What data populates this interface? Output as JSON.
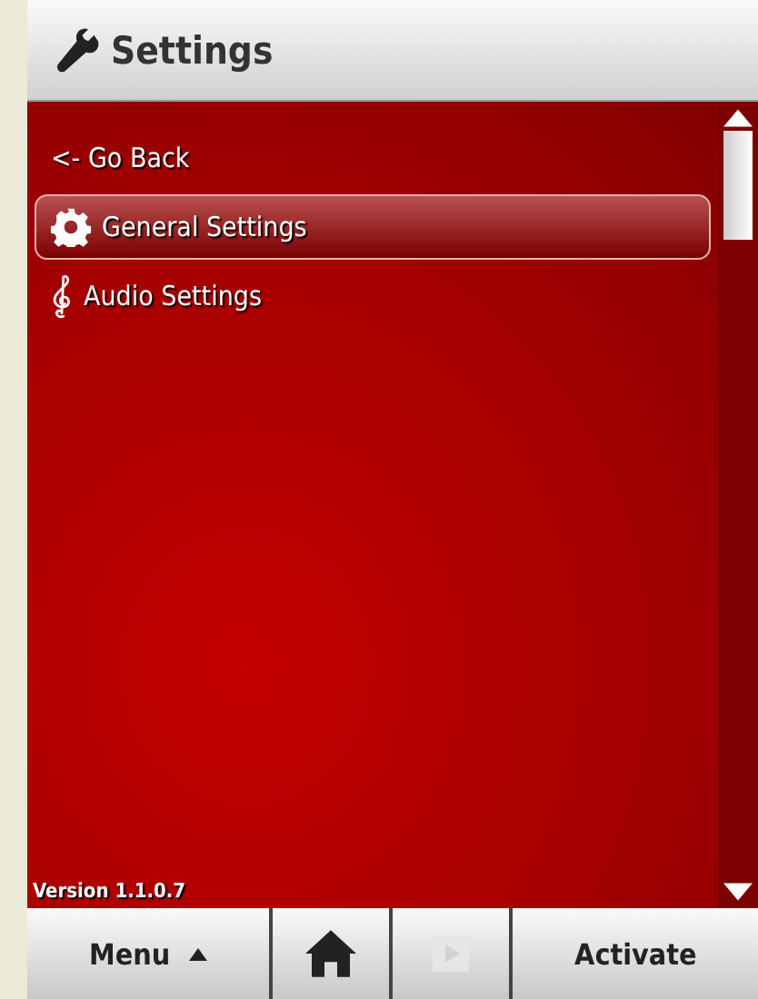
{
  "header": {
    "title": "Settings"
  },
  "menu_items": [
    {
      "label": "<- Go Back",
      "kind": "back",
      "selected": false
    },
    {
      "label": "General Settings",
      "kind": "gear",
      "selected": true
    },
    {
      "label": "Audio Settings",
      "kind": "clef",
      "selected": false
    }
  ],
  "version": "Version 1.1.0.7",
  "toolbar": {
    "menu_label": "Menu",
    "play_disabled": true,
    "action_label": "Activate"
  }
}
